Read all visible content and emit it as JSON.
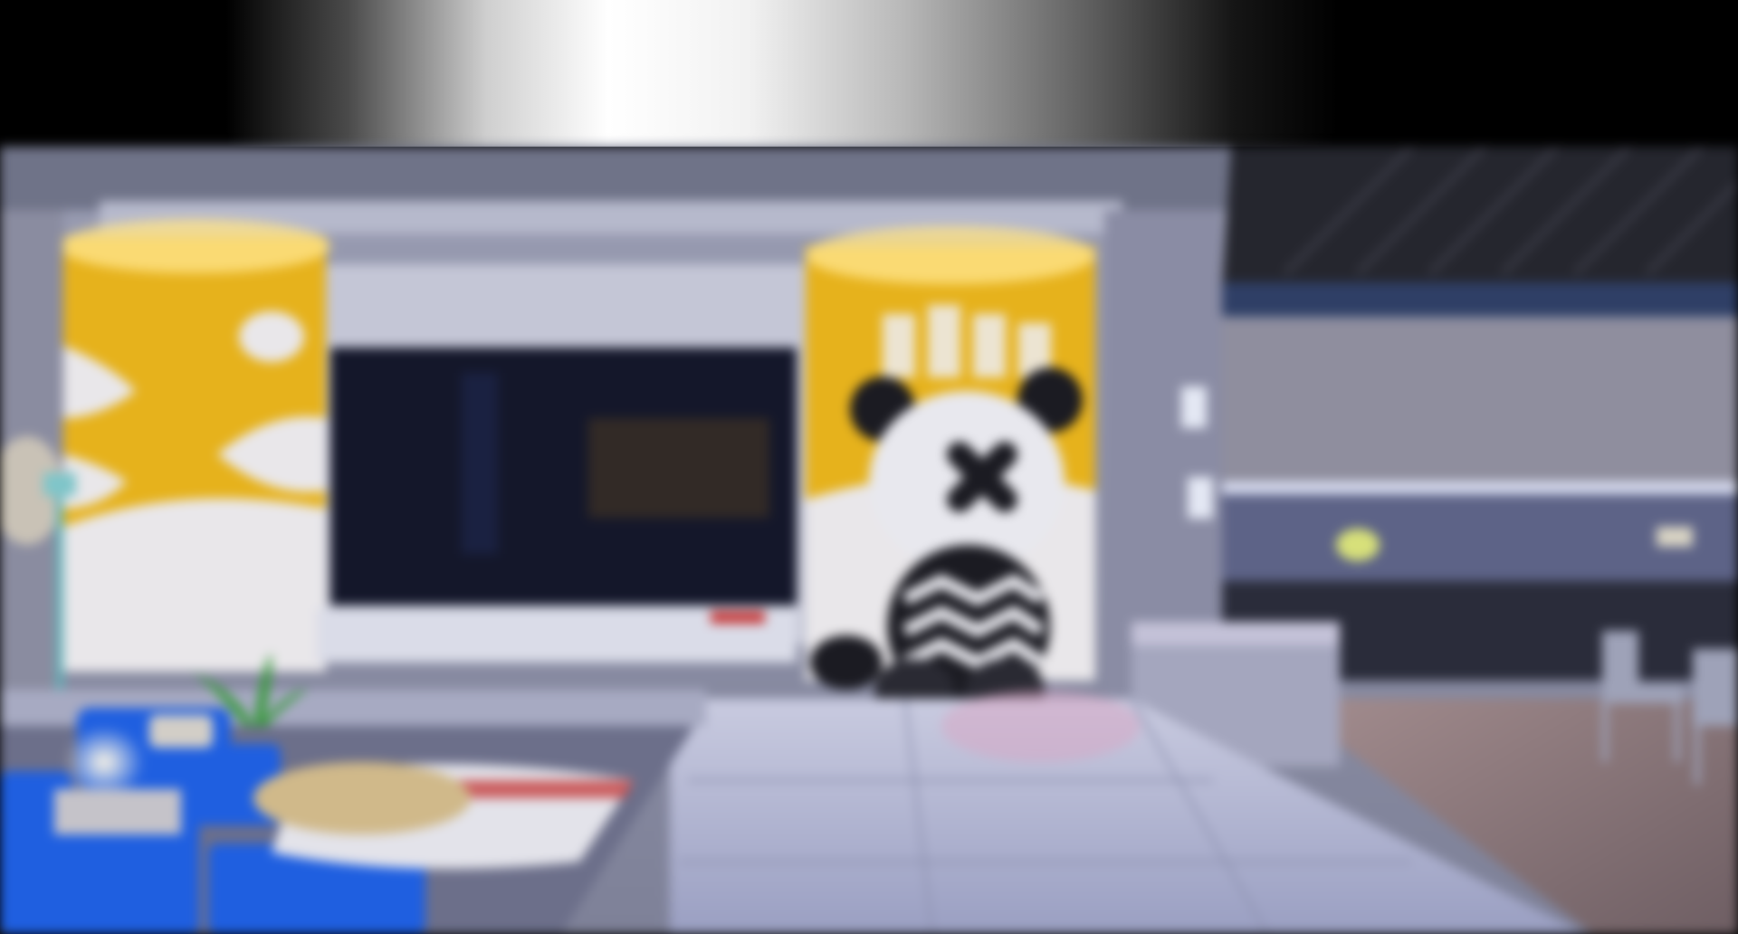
{
  "scene": {
    "name": "apartment-interior",
    "palette": {
      "wall": "#8f93a8",
      "ceiling": "#6d7185",
      "accent_yellow": "#e6b21c",
      "tv_screen": "#14172a",
      "floor_tile": "#b7bbd4",
      "wood_floor": "#8b7a7e",
      "sofa_blue": "#1f5fe0",
      "kitchen_counter": "#2a2c3a",
      "panda_white": "#e8e8ee",
      "panda_black": "#1b1b22"
    }
  }
}
